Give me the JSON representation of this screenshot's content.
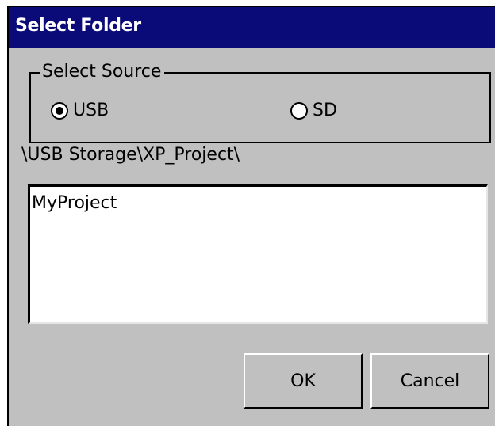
{
  "window": {
    "title": "Select Folder"
  },
  "source_group": {
    "legend": "Select Source",
    "options": [
      {
        "label": "USB",
        "selected": true
      },
      {
        "label": "SD",
        "selected": false
      }
    ]
  },
  "current_path": "\\USB Storage\\XP_Project\\",
  "folder_list": {
    "items": [
      "MyProject"
    ]
  },
  "buttons": {
    "ok_label": "OK",
    "cancel_label": "Cancel"
  },
  "colors": {
    "titlebar": "#0a0a78",
    "dialog_bg": "#c0c0c0",
    "list_bg": "#ffffff"
  }
}
